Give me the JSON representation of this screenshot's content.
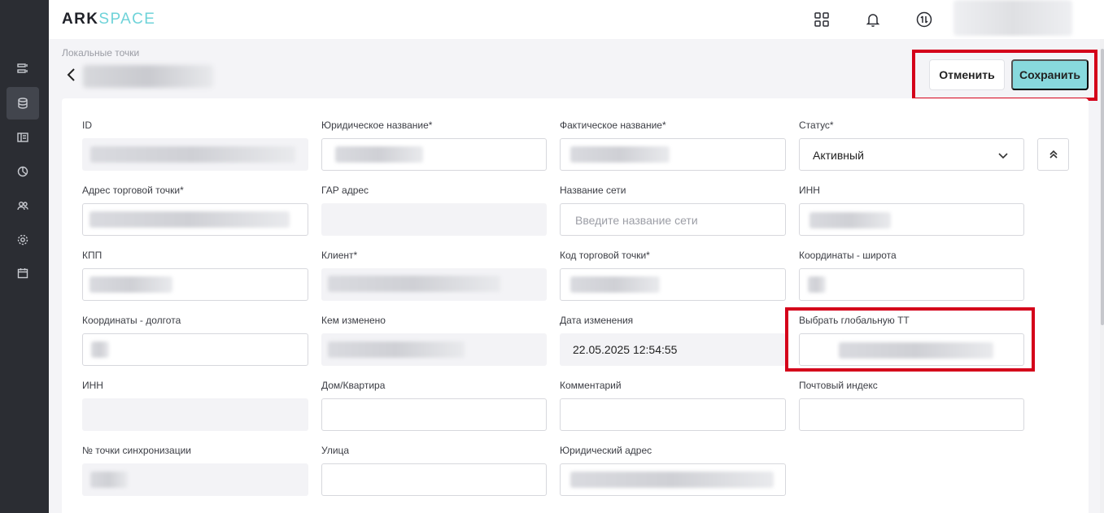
{
  "header": {
    "logo_ark": "ARK",
    "logo_space": "SPACE",
    "icons": [
      "apps-grid-icon",
      "bell-icon",
      "sync-arrows-icon"
    ]
  },
  "sidebar": {
    "items": [
      "list-icon",
      "database-icon",
      "layout-icon",
      "chart-icon",
      "users-icon",
      "gear-icon",
      "calendar-icon"
    ],
    "active_index": 1
  },
  "breadcrumb": "Локальные точки",
  "actions": {
    "cancel_label": "Отменить",
    "save_label": "Сохранить"
  },
  "form": {
    "id": {
      "label": "ID"
    },
    "legal_name": {
      "label": "Юридическое название*"
    },
    "actual_name": {
      "label": "Фактическое название*"
    },
    "status": {
      "label": "Статус*",
      "value": "Активный"
    },
    "store_address": {
      "label": "Адрес торговой точки*"
    },
    "gar_address": {
      "label": "ГАР адрес"
    },
    "network_name": {
      "label": "Название сети",
      "placeholder": "Введите название сети"
    },
    "inn": {
      "label": "ИНН"
    },
    "kpp": {
      "label": "КПП"
    },
    "client": {
      "label": "Клиент*"
    },
    "store_code": {
      "label": "Код торговой точки*"
    },
    "latitude": {
      "label": "Координаты - широта"
    },
    "longitude": {
      "label": "Координаты - долгота"
    },
    "changed_by": {
      "label": "Кем изменено"
    },
    "changed_date": {
      "label": "Дата изменения",
      "value": "22.05.2025 12:54:55"
    },
    "global_tt": {
      "label": "Выбрать глобальную ТТ"
    },
    "inn2": {
      "label": "ИНН"
    },
    "house_apartment": {
      "label": "Дом/Квартира"
    },
    "comment": {
      "label": "Комментарий"
    },
    "postal_code": {
      "label": "Почтовый индекс"
    },
    "sync_point_no": {
      "label": "№ точки синхронизации"
    },
    "street": {
      "label": "Улица"
    },
    "legal_address": {
      "label": "Юридический адрес"
    }
  },
  "colors": {
    "sidebar_bg": "#2b2d33",
    "accent": "#88d9dd",
    "highlight": "#d4001a"
  }
}
